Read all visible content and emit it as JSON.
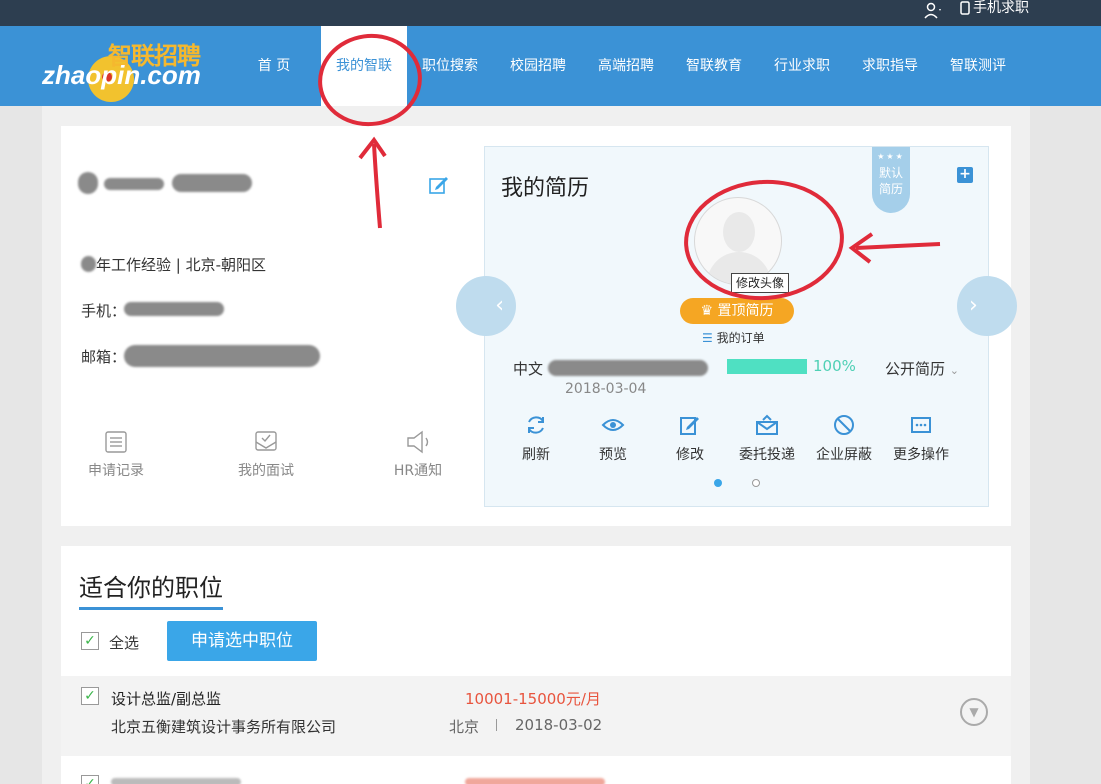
{
  "topbar": {
    "user_icon": "user-icon",
    "mobile_icon": "phone-icon",
    "mobile_label": "手机求职"
  },
  "logo": {
    "cn": "智联招聘",
    "en": "zhaopin.com"
  },
  "nav": {
    "items": [
      "首 页",
      "我的智联",
      "职位搜索",
      "校园招聘",
      "高端招聘",
      "智联教育",
      "行业求职",
      "求职指导",
      "智联测评"
    ],
    "active": "我的智联"
  },
  "profile": {
    "experience": "年工作经验 | 北京-朝阳区",
    "phone_label": "手机：",
    "email_label": "邮箱：",
    "edit_icon": "edit-icon",
    "quick_links": [
      {
        "label": "申请记录",
        "icon": "list-icon"
      },
      {
        "label": "我的面试",
        "icon": "interview-icon"
      },
      {
        "label": "HR通知",
        "icon": "speaker-icon"
      }
    ]
  },
  "resume": {
    "title": "我的简历",
    "ribbon": "默认简历",
    "add_icon": "plus-icon",
    "avatar_tooltip": "修改头像",
    "top_button": "置顶简历",
    "order_label": "我的订单",
    "name_prefix": "中文",
    "date": "2018-03-04",
    "progress": 100,
    "progress_label": "100%",
    "visibility": "公开简历",
    "actions": [
      {
        "label": "刷新",
        "icon": "refresh-icon"
      },
      {
        "label": "预览",
        "icon": "eye-icon"
      },
      {
        "label": "修改",
        "icon": "edit-icon"
      },
      {
        "label": "委托投递",
        "icon": "delegate-icon"
      },
      {
        "label": "企业屏蔽",
        "icon": "block-icon"
      },
      {
        "label": "更多操作",
        "icon": "more-icon"
      }
    ]
  },
  "jobs": {
    "title": "适合你的职位",
    "select_all": "全选",
    "apply_button": "申请选中职位",
    "items": [
      {
        "title": "设计总监/副总监",
        "salary": "10001-15000元/月",
        "company": "北京五衡建筑设计事务所有限公司",
        "city": "北京",
        "date": "2018-03-02"
      }
    ]
  },
  "colors": {
    "brand": "#3b92d6",
    "accent": "#f5a623",
    "salary": "#e8543e",
    "annotation": "#e02b3a"
  }
}
